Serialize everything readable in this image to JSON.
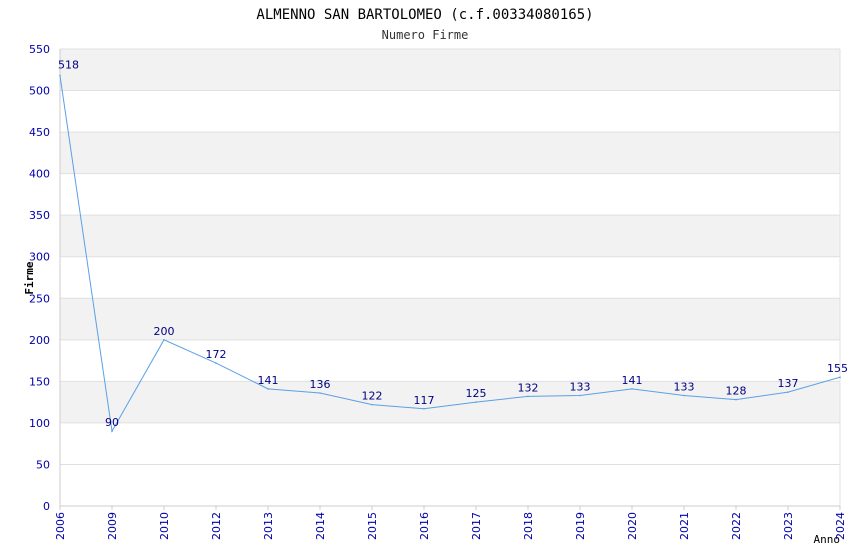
{
  "chart_data": {
    "type": "line",
    "title": "ALMENNO SAN BARTOLOMEO (c.f.00334080165)",
    "subtitle": "Numero Firme",
    "xlabel": "Anno",
    "ylabel": "Firme",
    "categories": [
      "2006",
      "2009",
      "2010",
      "2012",
      "2013",
      "2014",
      "2015",
      "2016",
      "2017",
      "2018",
      "2019",
      "2020",
      "2021",
      "2022",
      "2023",
      "2024"
    ],
    "values": [
      518,
      90,
      200,
      172,
      141,
      136,
      122,
      117,
      125,
      132,
      133,
      141,
      133,
      128,
      137,
      155
    ],
    "ylim": [
      0,
      550
    ],
    "yticks": [
      0,
      50,
      100,
      150,
      200,
      250,
      300,
      350,
      400,
      450,
      500,
      550
    ],
    "grid": true,
    "colors": {
      "line": "#5aa0e6",
      "band": "#f2f2f2",
      "tick_text": "#0000aa",
      "data_label": "#000080"
    }
  }
}
